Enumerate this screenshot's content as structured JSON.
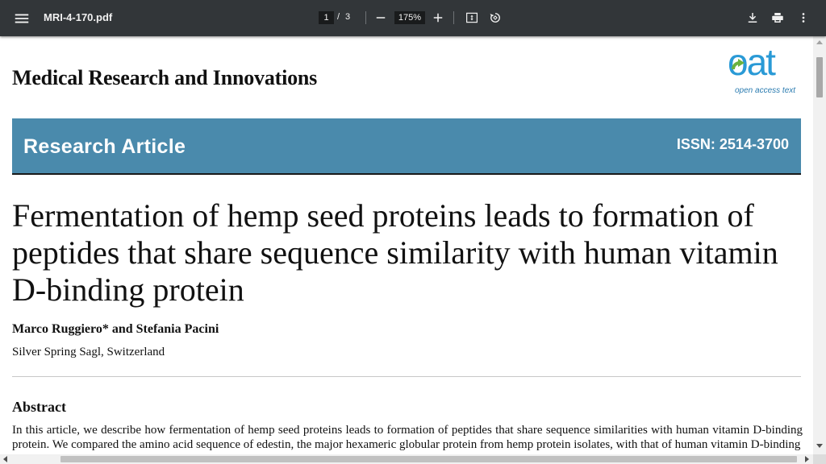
{
  "toolbar": {
    "file_name": "MRI-4-170.pdf",
    "current_page": "1",
    "page_separator": "/",
    "total_pages": "3",
    "zoom": "175%",
    "icons": [
      "menu-icon",
      "zoom-out-icon",
      "zoom-in-icon",
      "fit-page-icon",
      "rotate-icon",
      "download-icon",
      "print-icon",
      "more-vert-icon"
    ]
  },
  "document": {
    "journal_title": "Medical Research and Innovations",
    "logo": {
      "word": "oat",
      "tagline": "open access text",
      "color": "#2a9ad6",
      "arrow_color": "#6ab23e"
    },
    "banner": {
      "label": "Research Article",
      "issn": "ISSN: 2514-3700",
      "color": "#4a8aac"
    },
    "article_title": "Fermentation of hemp seed proteins leads to formation of peptides that share sequence similarity with human vitamin D-binding protein",
    "authors": "Marco Ruggiero* and Stefania Pacini",
    "affiliation": "Silver Spring Sagl, Switzerland",
    "abstract_heading": "Abstract",
    "abstract_text": "In this article, we describe how fermentation of hemp seed proteins leads to formation of peptides that share sequence similarities with  human vitamin D-binding protein. We compared the amino acid sequence of edestin, the major hexameric globular protein from hemp protein isolates, with that of human vitamin D-binding"
  }
}
